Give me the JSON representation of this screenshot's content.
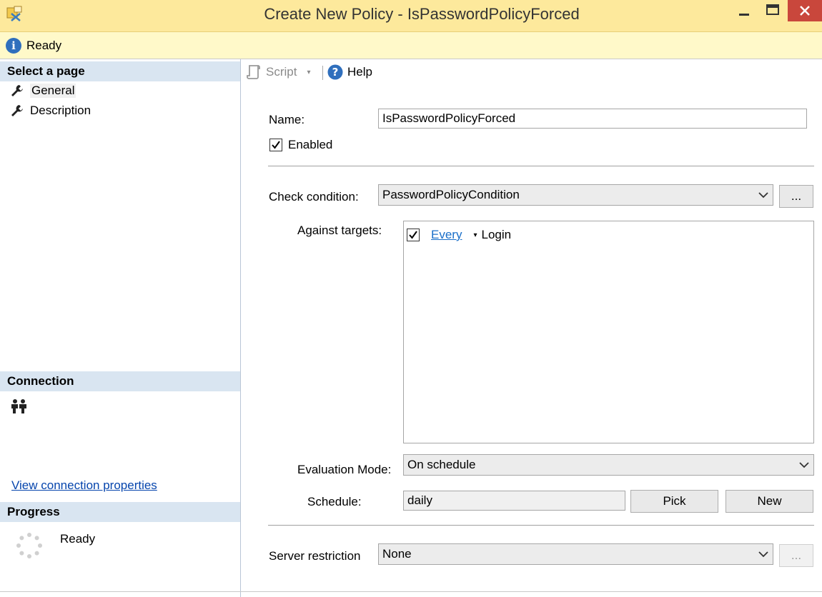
{
  "window": {
    "title": "Create New Policy - IsPasswordPolicyForced"
  },
  "status": {
    "text": "Ready"
  },
  "left": {
    "select_page_header": "Select a page",
    "pages": [
      {
        "label": "General"
      },
      {
        "label": "Description"
      }
    ],
    "connection_header": "Connection",
    "view_connection_link": "View connection properties",
    "progress_header": "Progress",
    "progress_text": "Ready"
  },
  "toolbar": {
    "script_label": "Script",
    "help_label": "Help"
  },
  "form": {
    "name_label": "Name:",
    "name_value": "IsPasswordPolicyForced",
    "enabled_label": "Enabled",
    "enabled_checked": true,
    "check_condition_label": "Check condition:",
    "check_condition_value": "PasswordPolicyCondition",
    "ellipsis": "...",
    "against_targets_label": "Against targets:",
    "targets": [
      {
        "qualifier": "Every",
        "object": "Login",
        "checked": true
      }
    ],
    "evaluation_mode_label": "Evaluation Mode:",
    "evaluation_mode_value": "On schedule",
    "schedule_label": "Schedule:",
    "schedule_value": "daily",
    "pick_label": "Pick",
    "new_label": "New",
    "server_restriction_label": "Server restriction",
    "server_restriction_value": "None"
  },
  "colors": {
    "titlebar": "#fde99c",
    "statusbar": "#fff9c9",
    "section_header": "#d9e5f1",
    "close_button": "#c9473c",
    "link": "#0645ad"
  }
}
